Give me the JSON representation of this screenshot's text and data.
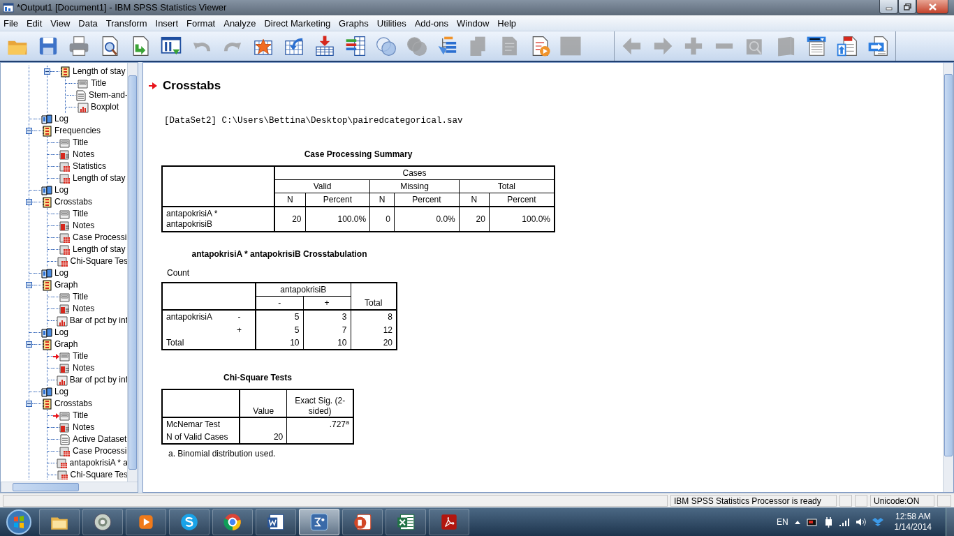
{
  "window": {
    "title": "*Output1 [Document1] - IBM SPSS Statistics Viewer"
  },
  "menu": [
    "File",
    "Edit",
    "View",
    "Data",
    "Transform",
    "Insert",
    "Format",
    "Analyze",
    "Direct Marketing",
    "Graphs",
    "Utilities",
    "Add-ons",
    "Window",
    "Help"
  ],
  "toolbar": [
    {
      "items": [
        {
          "kind": "folder",
          "disabled": false
        },
        {
          "kind": "disk",
          "disabled": false
        },
        {
          "kind": "printer",
          "disabled": false
        },
        {
          "kind": "preview",
          "disabled": false
        },
        {
          "kind": "recall",
          "disabled": false
        },
        {
          "kind": "goto-data",
          "disabled": false
        },
        {
          "kind": "undo",
          "disabled": true
        },
        {
          "kind": "redo",
          "disabled": true
        },
        {
          "kind": "star-grid",
          "disabled": false
        },
        {
          "kind": "grid-arrow",
          "disabled": false
        },
        {
          "kind": "insert-grid",
          "disabled": false
        },
        {
          "kind": "bars-grid",
          "disabled": false
        },
        {
          "kind": "circles",
          "disabled": false
        },
        {
          "kind": "circles",
          "disabled": true
        },
        {
          "kind": "split-tree",
          "disabled": false
        },
        {
          "kind": "pages",
          "disabled": true
        },
        {
          "kind": "doc",
          "disabled": true
        },
        {
          "kind": "doc-play",
          "disabled": false
        },
        {
          "kind": "frame",
          "disabled": true
        }
      ]
    },
    {
      "items": [
        {
          "kind": "arrow-left",
          "disabled": true
        },
        {
          "kind": "arrow-right",
          "disabled": true
        },
        {
          "kind": "plus",
          "disabled": true
        },
        {
          "kind": "minus",
          "disabled": true
        },
        {
          "kind": "magnifier-box",
          "disabled": true
        },
        {
          "kind": "book",
          "disabled": true
        },
        {
          "kind": "list-window",
          "disabled": false
        },
        {
          "kind": "doc-up",
          "disabled": false
        },
        {
          "kind": "doc-export",
          "disabled": false
        }
      ]
    }
  ],
  "outline": {
    "items": [
      {
        "kind": "continued",
        "children": [
          {
            "kind": "book",
            "label": "Length of stay",
            "expanded": true,
            "current": false,
            "children": [
              {
                "kind": "title",
                "label": "Title",
                "current": false
              },
              {
                "kind": "text",
                "label": "Stem-and-",
                "current": false
              },
              {
                "kind": "chart",
                "label": "Boxplot",
                "current": false
              }
            ]
          }
        ]
      },
      {
        "kind": "log",
        "label": "Log",
        "current": false
      },
      {
        "kind": "book",
        "label": "Frequencies",
        "expanded": true,
        "current": false,
        "children": [
          {
            "kind": "title",
            "label": "Title",
            "current": false
          },
          {
            "kind": "notes",
            "label": "Notes",
            "current": false
          },
          {
            "kind": "table",
            "label": "Statistics",
            "current": false
          },
          {
            "kind": "table",
            "label": "Length of stay",
            "current": false
          }
        ]
      },
      {
        "kind": "log",
        "label": "Log",
        "current": false
      },
      {
        "kind": "book",
        "label": "Crosstabs",
        "expanded": true,
        "current": false,
        "children": [
          {
            "kind": "title",
            "label": "Title",
            "current": false
          },
          {
            "kind": "notes",
            "label": "Notes",
            "current": false
          },
          {
            "kind": "table",
            "label": "Case Processi",
            "current": false
          },
          {
            "kind": "table",
            "label": "Length of stay",
            "current": false
          },
          {
            "kind": "table",
            "label": "Chi-Square Tes",
            "current": false
          }
        ]
      },
      {
        "kind": "log",
        "label": "Log",
        "current": false
      },
      {
        "kind": "book",
        "label": "Graph",
        "expanded": true,
        "current": false,
        "children": [
          {
            "kind": "title",
            "label": "Title",
            "current": false
          },
          {
            "kind": "notes",
            "label": "Notes",
            "current": false
          },
          {
            "kind": "chart",
            "label": "Bar of pct by inf",
            "current": false
          }
        ]
      },
      {
        "kind": "log",
        "label": "Log",
        "current": false
      },
      {
        "kind": "book",
        "label": "Graph",
        "expanded": true,
        "current": false,
        "children": [
          {
            "kind": "title",
            "label": "Title",
            "current": true
          },
          {
            "kind": "notes",
            "label": "Notes",
            "current": false
          },
          {
            "kind": "chart",
            "label": "Bar of pct by inf",
            "current": false
          }
        ]
      },
      {
        "kind": "log",
        "label": "Log",
        "current": false
      },
      {
        "kind": "book",
        "label": "Crosstabs",
        "expanded": true,
        "current": false,
        "children": [
          {
            "kind": "title",
            "label": "Title",
            "current": true
          },
          {
            "kind": "notes",
            "label": "Notes",
            "current": false
          },
          {
            "kind": "text",
            "label": "Active Dataset",
            "current": false
          },
          {
            "kind": "table",
            "label": "Case Processi",
            "current": false
          },
          {
            "kind": "table",
            "label": "antapokrisiA * a",
            "current": false
          },
          {
            "kind": "table",
            "label": "Chi-Square Tes",
            "current": false
          }
        ]
      }
    ]
  },
  "content": {
    "heading": {
      "text": "Crosstabs",
      "current": true
    },
    "dataset": "[DataSet2] C:\\Users\\Bettina\\Desktop\\pairedcategorical.sav",
    "case_processing": {
      "title": "Case Processing Summary",
      "group_header": "Cases",
      "groups": [
        {
          "label": "Valid",
          "columns": [
            "N",
            "Percent"
          ]
        },
        {
          "label": "Missing",
          "columns": [
            "N",
            "Percent"
          ]
        },
        {
          "label": "Total",
          "columns": [
            "N",
            "Percent"
          ]
        }
      ],
      "rows": [
        {
          "label": "antapokrisiA * antapokrisiB",
          "values": [
            "20",
            "100.0%",
            "0",
            "0.0%",
            "20",
            "100.0%"
          ]
        }
      ]
    },
    "crosstab": {
      "title": "antapokrisiA * antapokrisiB Crosstabulation",
      "subtitle": "Count",
      "column_variable": "antapokrisiB",
      "categories": [
        "-",
        "+"
      ],
      "total_label": "Total",
      "row_variable": "antapokrisiA",
      "rows": [
        {
          "category": "-",
          "values": [
            "5",
            "3",
            "8"
          ]
        },
        {
          "category": "+",
          "values": [
            "5",
            "7",
            "12"
          ]
        }
      ],
      "total_row": {
        "label": "Total",
        "values": [
          "10",
          "10",
          "20"
        ]
      }
    },
    "chi_square": {
      "title": "Chi-Square Tests",
      "columns": [
        "Value",
        "Exact Sig. (2-sided)"
      ],
      "rows": [
        {
          "label": "McNemar Test",
          "exact_sig": ".727$^{a}$"
        },
        {
          "label": "N of Valid Cases",
          "value": "20"
        }
      ],
      "footnote": "a. Binomial distribution used."
    }
  },
  "status_bar": {
    "message": "IBM SPSS Statistics Processor is ready",
    "encoding": "Unicode:ON"
  },
  "taskbar": {
    "apps": [
      {
        "kind": "explorer",
        "active": false
      },
      {
        "kind": "disc",
        "active": false
      },
      {
        "kind": "player",
        "active": false
      },
      {
        "kind": "skype",
        "active": false
      },
      {
        "kind": "chrome",
        "active": false
      },
      {
        "kind": "word",
        "active": false
      },
      {
        "kind": "spss",
        "active": true
      },
      {
        "kind": "powerpoint",
        "active": false
      },
      {
        "kind": "excel",
        "active": false
      },
      {
        "kind": "acrobat",
        "active": false
      }
    ],
    "language": "EN",
    "time": "12:58 AM",
    "date": "1/14/2014"
  }
}
